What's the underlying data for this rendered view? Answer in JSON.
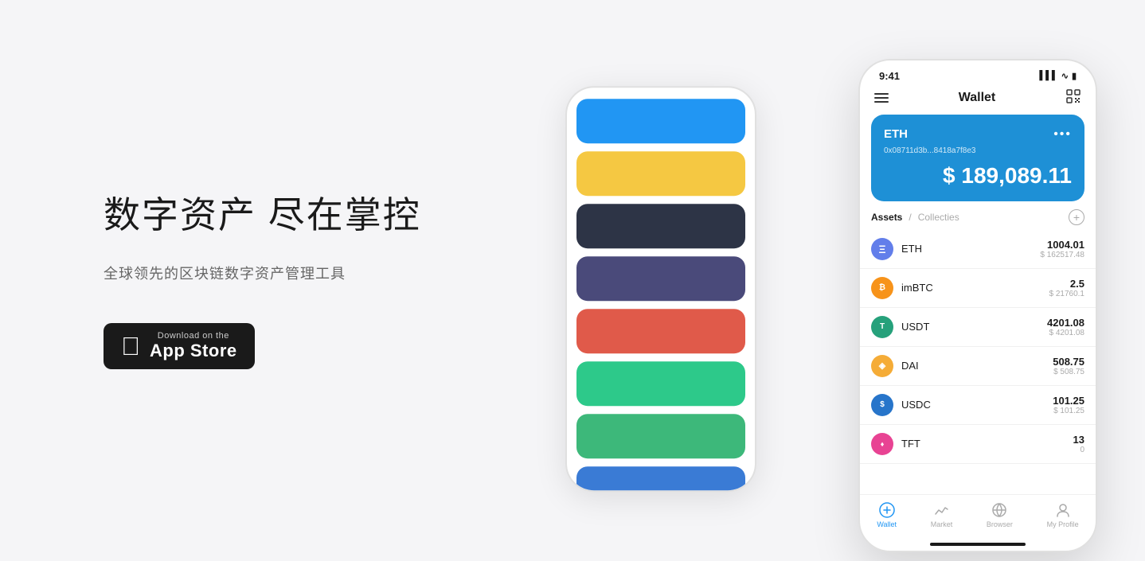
{
  "page": {
    "background": "#f5f5f7"
  },
  "hero": {
    "title": "数字资产 尽在掌控",
    "subtitle": "全球领先的区块链数字资产管理工具"
  },
  "app_store_btn": {
    "small_text": "Download on the",
    "large_text": "App Store"
  },
  "phone_front": {
    "status_time": "9:41",
    "nav_title": "Wallet",
    "eth_symbol": "ETH",
    "eth_address": "0x08711d3b...8418a7f8e3",
    "eth_balance": "$ 189,089.11",
    "assets_tab": "Assets",
    "collectibles_tab": "Collecties",
    "assets": [
      {
        "icon": "ETH",
        "name": "ETH",
        "amount": "1004.01",
        "usd": "$ 162517.48",
        "type": "eth"
      },
      {
        "icon": "B",
        "name": "imBTC",
        "amount": "2.5",
        "usd": "$ 21760.1",
        "type": "imbtc"
      },
      {
        "icon": "T",
        "name": "USDT",
        "amount": "4201.08",
        "usd": "$ 4201.08",
        "type": "usdt"
      },
      {
        "icon": "D",
        "name": "DAI",
        "amount": "508.75",
        "usd": "$ 508.75",
        "type": "dai"
      },
      {
        "icon": "$",
        "name": "USDC",
        "amount": "101.25",
        "usd": "$ 101.25",
        "type": "usdc"
      },
      {
        "icon": "T",
        "name": "TFT",
        "amount": "13",
        "usd": "0",
        "type": "tft"
      }
    ],
    "bottom_nav": [
      {
        "label": "Wallet",
        "active": true
      },
      {
        "label": "Market",
        "active": false
      },
      {
        "label": "Browser",
        "active": false
      },
      {
        "label": "My Profile",
        "active": false
      }
    ]
  },
  "color_cards": [
    {
      "color": "#2196f3",
      "label": "blue"
    },
    {
      "color": "#f5c842",
      "label": "yellow"
    },
    {
      "color": "#2d3446",
      "label": "dark"
    },
    {
      "color": "#4a4a7a",
      "label": "purple"
    },
    {
      "color": "#e05a4a",
      "label": "red"
    },
    {
      "color": "#2dc98a",
      "label": "green1"
    },
    {
      "color": "#3db87a",
      "label": "green2"
    },
    {
      "color": "#3a7bd5",
      "label": "blue2"
    }
  ]
}
